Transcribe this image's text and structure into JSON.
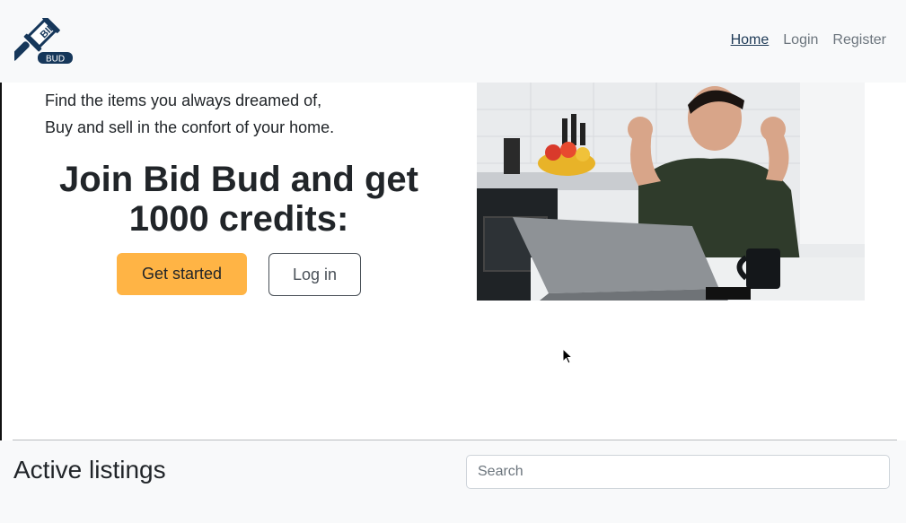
{
  "navbar": {
    "brand_top": "BID",
    "brand_bottom": "BUD",
    "links": [
      {
        "label": "Home",
        "active": true
      },
      {
        "label": "Login",
        "active": false
      },
      {
        "label": "Register",
        "active": false
      }
    ]
  },
  "hero": {
    "tagline_line1": "Find the items you always dreamed of,",
    "tagline_line2": "Buy and sell in the confort of your home.",
    "headline_line1": "Join Bid Bud and get",
    "headline_line2": "1000 credits:",
    "get_started_label": "Get started",
    "login_label": "Log in"
  },
  "listings": {
    "title": "Active listings",
    "search_placeholder": "Search"
  },
  "colors": {
    "accent": "#ffb445",
    "brand_navy": "#16375a",
    "navbar_bg": "#f8f9fa"
  },
  "icons": [
    "gavel-logo-icon",
    "mouse-cursor-icon"
  ]
}
